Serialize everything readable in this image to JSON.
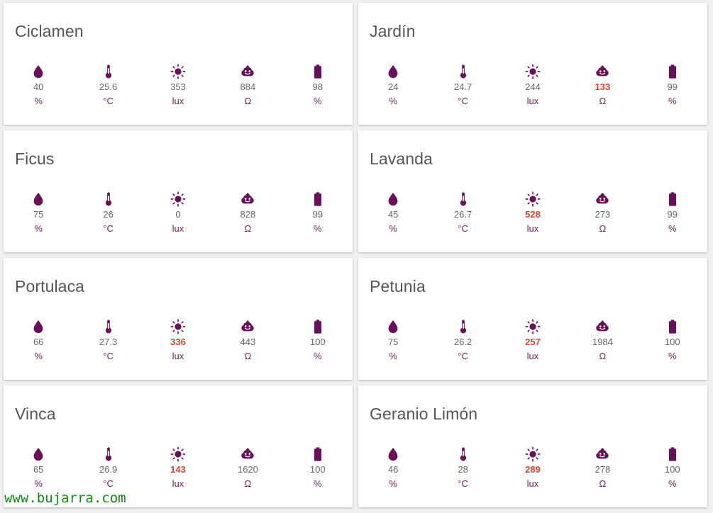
{
  "colors": {
    "icon": "#6a0f5a",
    "unit": "#7a1a63",
    "value": "#666666",
    "alert": "#d9452f"
  },
  "sensor_icons": [
    "water-drop-icon",
    "thermometer-icon",
    "sun-icon",
    "poop-icon",
    "battery-icon"
  ],
  "plants": [
    {
      "name": "Ciclamen",
      "sensors": [
        {
          "value": "40",
          "unit": "%"
        },
        {
          "value": "25.6",
          "unit": "°C"
        },
        {
          "value": "353",
          "unit": "lux"
        },
        {
          "value": "884",
          "unit": "Ω"
        },
        {
          "value": "98",
          "unit": "%"
        }
      ]
    },
    {
      "name": "Jardín",
      "sensors": [
        {
          "value": "24",
          "unit": "%"
        },
        {
          "value": "24.7",
          "unit": "°C"
        },
        {
          "value": "244",
          "unit": "lux"
        },
        {
          "value": "133",
          "unit": "Ω",
          "alert": true
        },
        {
          "value": "99",
          "unit": "%"
        }
      ]
    },
    {
      "name": "Ficus",
      "sensors": [
        {
          "value": "75",
          "unit": "%"
        },
        {
          "value": "26",
          "unit": "°C"
        },
        {
          "value": "0",
          "unit": "lux"
        },
        {
          "value": "828",
          "unit": "Ω"
        },
        {
          "value": "99",
          "unit": "%"
        }
      ]
    },
    {
      "name": "Lavanda",
      "sensors": [
        {
          "value": "45",
          "unit": "%"
        },
        {
          "value": "26.7",
          "unit": "°C"
        },
        {
          "value": "528",
          "unit": "lux",
          "alert": true
        },
        {
          "value": "273",
          "unit": "Ω"
        },
        {
          "value": "99",
          "unit": "%"
        }
      ]
    },
    {
      "name": "Portulaca",
      "sensors": [
        {
          "value": "66",
          "unit": "%"
        },
        {
          "value": "27.3",
          "unit": "°C"
        },
        {
          "value": "336",
          "unit": "lux",
          "alert": true
        },
        {
          "value": "443",
          "unit": "Ω"
        },
        {
          "value": "100",
          "unit": "%"
        }
      ]
    },
    {
      "name": "Petunia",
      "sensors": [
        {
          "value": "75",
          "unit": "%"
        },
        {
          "value": "26.2",
          "unit": "°C"
        },
        {
          "value": "257",
          "unit": "lux",
          "alert": true
        },
        {
          "value": "1984",
          "unit": "Ω"
        },
        {
          "value": "100",
          "unit": "%"
        }
      ]
    },
    {
      "name": "Vinca",
      "sensors": [
        {
          "value": "65",
          "unit": "%"
        },
        {
          "value": "26.9",
          "unit": "°C"
        },
        {
          "value": "143",
          "unit": "lux",
          "alert": true
        },
        {
          "value": "1620",
          "unit": "Ω"
        },
        {
          "value": "100",
          "unit": "%"
        }
      ]
    },
    {
      "name": "Geranio Limón",
      "sensors": [
        {
          "value": "46",
          "unit": "%"
        },
        {
          "value": "28",
          "unit": "°C"
        },
        {
          "value": "289",
          "unit": "lux",
          "alert": true
        },
        {
          "value": "278",
          "unit": "Ω"
        },
        {
          "value": "100",
          "unit": "%"
        }
      ]
    }
  ],
  "watermark": "www.bujarra.com"
}
